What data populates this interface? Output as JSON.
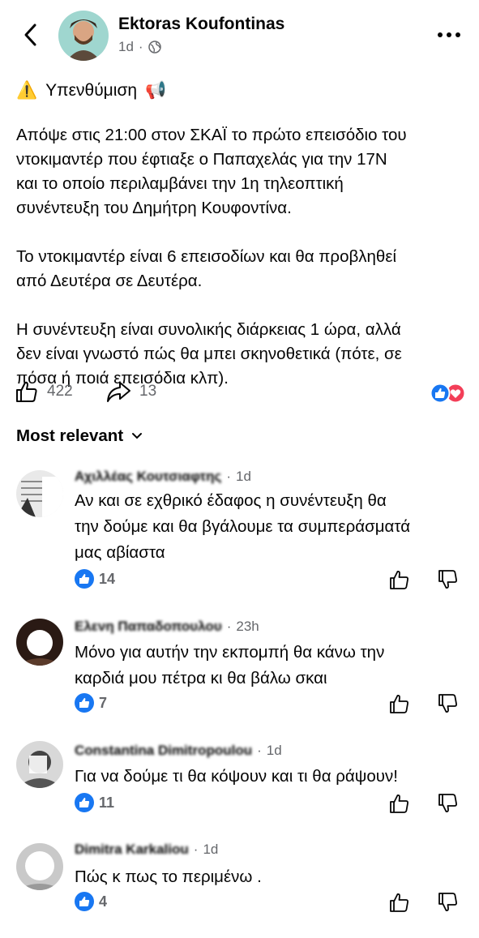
{
  "header": {
    "author": "Ektoras Koufontinas",
    "time": "1d",
    "privacy_icon": "globe-icon"
  },
  "post": {
    "title_emoji_left": "⚠️",
    "title": "Υπενθύμιση",
    "title_emoji_right": "📢",
    "paragraphs": [
      "Απόψε στις 21:00 στον ΣΚΑΪ το πρώτο επεισόδιο του\nντοκιμαντέρ που έφτιαξε ο Παπαχελάς για την 17Ν\nκαι το οποίο περιλαμβάνει την 1η τηλεοπτική\nσυνέντευξη του Δημήτρη Κουφοντίνα.",
      "Το ντοκιμαντέρ είναι 6 επεισοδίων και θα προβληθεί\nαπό Δευτέρα σε Δευτέρα.",
      "Η συνέντευξη είναι συνολικής διάρκειας 1 ώρα, αλλά\nδεν είναι γνωστό πώς θα μπει σκηνοθετικά (πότε, σε\nπόσα ή ποιά επεισόδια κλπ)."
    ],
    "likes": "422",
    "shares": "13",
    "colors": {
      "like_blue": "#1877f2",
      "love_red": "#f33e58"
    }
  },
  "sort_label": "Most relevant",
  "comments": [
    {
      "name": "Αχιλλέας Κουτσιαφτης",
      "time": "1d",
      "text": "Αν και σε εχθρικό έδαφος η συνέντευξη θα\nτην δούμε και θα βγάλουμε τα συμπεράσματά\nμας αβίαστα",
      "likes": "14"
    },
    {
      "name": "Ελενη Παπαδοπουλου",
      "time": "23h",
      "text": "Μόνο για αυτήν την εκπομπή θα κάνω την\nκαρδιά μου πέτρα κι θα βάλω σκαι",
      "likes": "7"
    },
    {
      "name": "Constantina Dimitropoulou",
      "time": "1d",
      "text": "Για να δούμε τι θα κόψουν και τι θα ράψουν!",
      "likes": "11"
    },
    {
      "name": "Dimitra Karkaliou",
      "time": "1d",
      "text": "Πώς κ πως το περιμένω .",
      "likes": "4"
    }
  ]
}
